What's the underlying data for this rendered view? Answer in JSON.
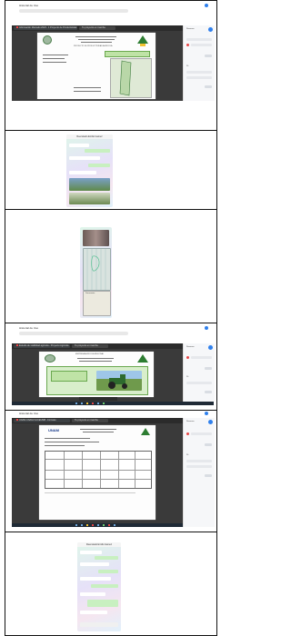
{
  "sections": [
    {
      "type": "browser-pdf",
      "window_title": "Historial de Uso",
      "address": "Guardar en línea · Mi Sitio",
      "tabs": [
        "Información Mercado 2023 - 1 Proyecto de Productividad",
        "Tu proyecto en marcha"
      ],
      "doc_heading": "PROYECTO DE PRODUCTIVIDAD AGRICOLA",
      "side_panel": {
        "label": "Resumen",
        "button": "Descargar",
        "count": "20"
      }
    },
    {
      "type": "phone-chat",
      "header": "Reenviado Emilio Gamez",
      "messages": 6
    },
    {
      "type": "phone-photo-doc",
      "caption": "Documento"
    },
    {
      "type": "browser-pdf",
      "window_title": "Historial de Uso",
      "address": "Mi Sitio",
      "tabs": [
        "Estudio de viabilidad agrícola - Proyecto Agrícola",
        "Tu proyecto en marcha"
      ],
      "doc_heading": "EMPRESA AGRICOLA REGIONAL",
      "side_panel": {
        "label": "Resumen",
        "button": "Descargar",
        "count": "20"
      }
    },
    {
      "type": "browser-pdf",
      "window_title": "Historial de Uso",
      "address": "Mi Sitio",
      "tabs": [
        "UNAM UNAM-VLICEUMB - Formato",
        "Tu proyecto en marcha"
      ],
      "doc_heading": "UNAM",
      "side_panel": {
        "label": "Resumen",
        "button": "Descargar",
        "count": "20"
      }
    },
    {
      "type": "phone-chat",
      "header": "Reenviado Emilio Gamez",
      "messages": 9
    }
  ],
  "colors": {
    "accent": "#2f80ed",
    "viewer_bg": "#3a3a3a",
    "green_logo": "#2e7d32",
    "chat_out": "#c8f0c0"
  }
}
